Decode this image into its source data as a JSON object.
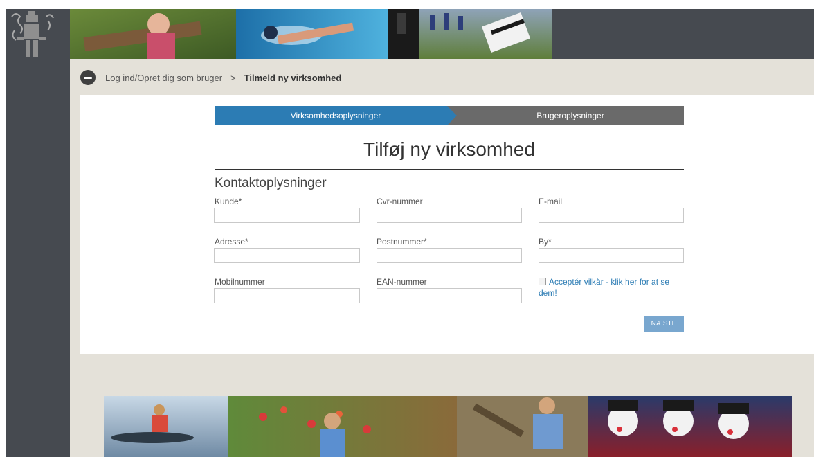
{
  "breadcrumb": {
    "link": "Log ind/Opret dig som bruger",
    "separator": ">",
    "current": "Tilmeld ny virksomhed"
  },
  "steps": [
    {
      "label": "Virksomhedsoplysninger",
      "active": true
    },
    {
      "label": "Brugeroplysninger",
      "active": false
    }
  ],
  "form": {
    "title": "Tilføj ny virksomhed",
    "section": "Kontaktoplysninger",
    "fields": {
      "kunde": {
        "label": "Kunde*",
        "value": ""
      },
      "cvr": {
        "label": "Cvr-nummer",
        "value": ""
      },
      "email": {
        "label": "E-mail",
        "value": ""
      },
      "adresse": {
        "label": "Adresse*",
        "value": ""
      },
      "postnummer": {
        "label": "Postnummer*",
        "value": ""
      },
      "by": {
        "label": "By*",
        "value": ""
      },
      "mobil": {
        "label": "Mobilnummer",
        "value": ""
      },
      "ean": {
        "label": "EAN-nummer",
        "value": ""
      }
    },
    "terms": "Acceptér vilkår - klik her for at se dem!",
    "next_label": "NÆSTE"
  },
  "colors": {
    "primary": "#2c7cb4",
    "step_inactive": "#6a6a6a",
    "rail": "#464a50",
    "page_bg": "#e4e1d9",
    "button": "#79a7cf"
  },
  "icons": {
    "back": "back-arrow-icon",
    "logo": "municipality-crest-icon"
  }
}
